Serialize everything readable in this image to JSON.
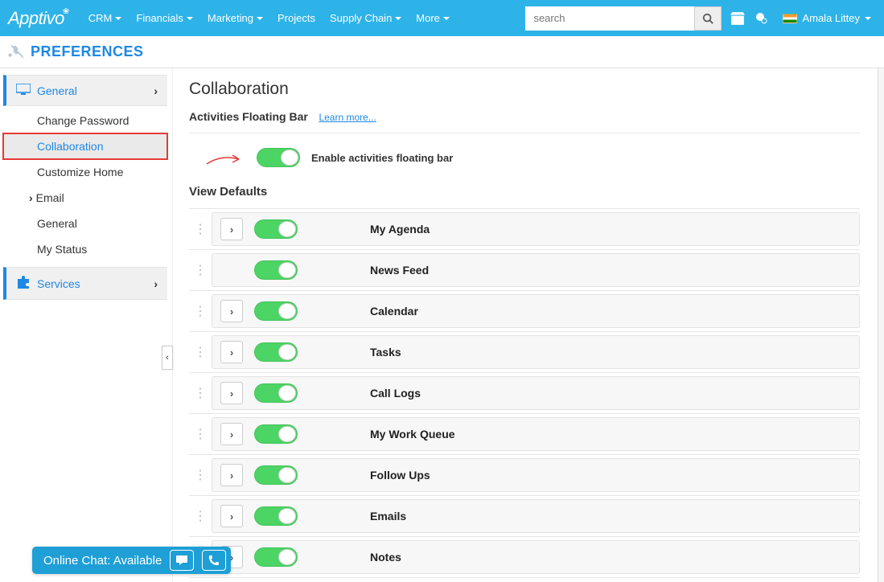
{
  "brand": "Apptivo",
  "topnav": {
    "items": [
      {
        "label": "CRM",
        "caret": true
      },
      {
        "label": "Financials",
        "caret": true
      },
      {
        "label": "Marketing",
        "caret": true
      },
      {
        "label": "Projects",
        "caret": false
      },
      {
        "label": "Supply Chain",
        "caret": true
      },
      {
        "label": "More",
        "caret": true
      }
    ]
  },
  "search": {
    "placeholder": "search"
  },
  "user": {
    "name": "Amala Littey"
  },
  "prefs_title": "PREFERENCES",
  "sidebar": {
    "general": {
      "label": "General",
      "items": [
        {
          "label": "Change Password"
        },
        {
          "label": "Collaboration",
          "active": true
        },
        {
          "label": "Customize Home"
        }
      ],
      "email_label": "Email",
      "post_items": [
        {
          "label": "General"
        },
        {
          "label": "My Status"
        }
      ]
    },
    "services": {
      "label": "Services"
    }
  },
  "page": {
    "title": "Collaboration",
    "afb_label": "Activities Floating Bar",
    "learn_more": "Learn more...",
    "enable_label": "Enable activities floating bar",
    "view_defaults_label": "View Defaults",
    "views": [
      {
        "label": "My Agenda",
        "expandable": true
      },
      {
        "label": "News Feed",
        "expandable": false
      },
      {
        "label": "Calendar",
        "expandable": true
      },
      {
        "label": "Tasks",
        "expandable": true
      },
      {
        "label": "Call Logs",
        "expandable": true
      },
      {
        "label": "My Work Queue",
        "expandable": true
      },
      {
        "label": "Follow Ups",
        "expandable": true
      },
      {
        "label": "Emails",
        "expandable": true
      },
      {
        "label": "Notes",
        "expandable": true
      }
    ]
  },
  "chat": {
    "status": "Online Chat: Available"
  }
}
